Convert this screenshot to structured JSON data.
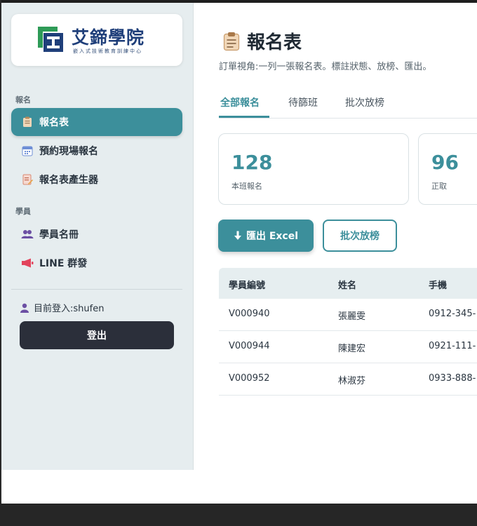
{
  "brand": {
    "name": "艾鍗學院",
    "tagline": "嵌入式技術教育訓練中心",
    "colors": {
      "accent": "#3c8f9b",
      "logo_blue": "#1f3f7a",
      "logo_green": "#2e9b57"
    }
  },
  "sidebar": {
    "sections": [
      {
        "label": "報名",
        "items": [
          {
            "label": "報名表",
            "icon": "clipboard-icon",
            "active": true
          },
          {
            "label": "預約現場報名",
            "icon": "calendar-icon",
            "active": false
          },
          {
            "label": "報名表產生器",
            "icon": "form-generator-icon",
            "active": false
          }
        ]
      },
      {
        "label": "學員",
        "items": [
          {
            "label": "學員名冊",
            "icon": "users-icon",
            "active": false
          },
          {
            "label": "LINE 群發",
            "icon": "megaphone-icon",
            "active": false
          }
        ]
      }
    ],
    "login_text": "目前登入:shufen",
    "logout_label": "登出"
  },
  "page": {
    "title": "報名表",
    "subtitle": "訂單視角:一列一張報名表。標註狀態、放榜、匯出。",
    "tabs": [
      {
        "label": "全部報名",
        "active": true
      },
      {
        "label": "待篩班",
        "active": false
      },
      {
        "label": "批次放榜",
        "active": false
      }
    ],
    "stats": [
      {
        "value": "128",
        "label": "本班報名"
      },
      {
        "value": "96",
        "label": "正取"
      }
    ],
    "actions": {
      "export_label": "匯出 Excel",
      "batch_label": "批次放榜"
    },
    "table": {
      "columns": [
        "學員編號",
        "姓名",
        "手機"
      ],
      "rows": [
        [
          "V000940",
          "張麗雯",
          "0912-345-"
        ],
        [
          "V000944",
          "陳建宏",
          "0921-111-"
        ],
        [
          "V000952",
          "林淑芬",
          "0933-888-"
        ]
      ]
    }
  }
}
